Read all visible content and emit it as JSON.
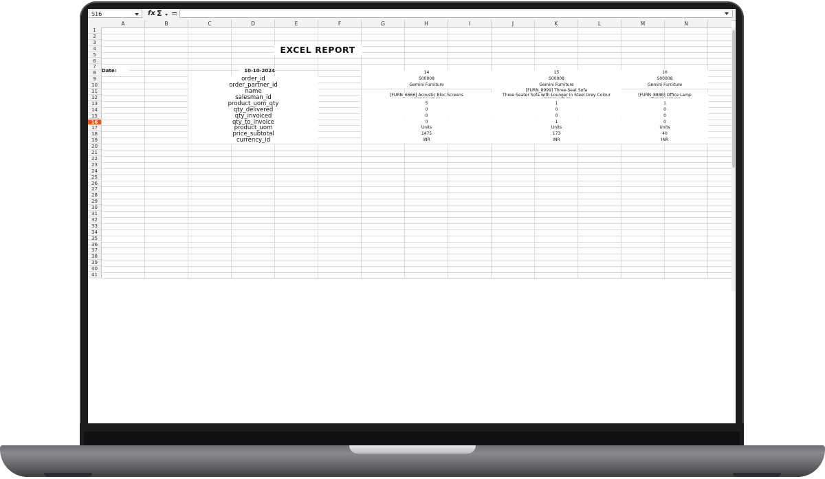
{
  "formula_bar": {
    "cell_ref": "S16",
    "fx_symbol": "fx",
    "sigma_symbol": "Σ",
    "equals_symbol": "="
  },
  "grid": {
    "columns": [
      "A",
      "B",
      "C",
      "D",
      "E",
      "F",
      "G",
      "H",
      "I",
      "J",
      "K",
      "L",
      "M",
      "N"
    ],
    "rows": [
      "1",
      "2",
      "3",
      "4",
      "5",
      "6",
      "7",
      "8",
      "9",
      "10",
      "11",
      "12",
      "13",
      "14",
      "15",
      "16",
      "17",
      "18",
      "19",
      "20",
      "21",
      "22",
      "23",
      "24",
      "25",
      "26",
      "27",
      "28",
      "29",
      "30",
      "31",
      "32",
      "33",
      "34",
      "35",
      "36",
      "37",
      "38",
      "39",
      "40",
      "41"
    ],
    "selected_row": "16"
  },
  "report": {
    "title": "EXCEL REPORT",
    "date_label": "Date:",
    "date_value": "10-10-2024",
    "field_labels": [
      "order_id",
      "order_partner_id",
      "name",
      "salesman_id",
      "product_uom_qty",
      "qty_delivered",
      "qty_invoiced",
      "qty_to_invoice",
      "product_uom",
      "price_subtotal",
      "currency_id"
    ],
    "records": [
      {
        "id": "14",
        "order_id": "S00008",
        "order_partner_id": "Gemini Furniture",
        "name_line1": "",
        "name_line2": "[FURN_6666] Acoustic Bloc Screens",
        "salesman_id": "Mitchell Admin",
        "product_uom_qty": "5",
        "qty_delivered": "0",
        "qty_invoiced": "0",
        "qty_to_invoice": "0",
        "product_uom": "Units",
        "price_subtotal": "1475",
        "currency_id": "INR"
      },
      {
        "id": "15",
        "order_id": "S00008",
        "order_partner_id": "Gemini Furniture",
        "name_line1": "[FURN_8999] Three-Seat Sofa",
        "name_line2": "Three Seater Sofa with Lounger in Steel Grey Colour",
        "salesman_id": "Mitchell Admin",
        "product_uom_qty": "1",
        "qty_delivered": "0",
        "qty_invoiced": "0",
        "qty_to_invoice": "1",
        "product_uom": "Units",
        "price_subtotal": "173",
        "currency_id": "INR"
      },
      {
        "id": "16",
        "order_id": "S00008",
        "order_partner_id": "Gemini Furniture",
        "name_line1": "",
        "name_line2": "[FURN_8888] Office Lamp",
        "salesman_id": "Mitchell Admin",
        "product_uom_qty": "1",
        "qty_delivered": "0",
        "qty_invoiced": "0",
        "qty_to_invoice": "0",
        "product_uom": "Units",
        "price_subtotal": "40",
        "currency_id": "INR"
      }
    ]
  }
}
